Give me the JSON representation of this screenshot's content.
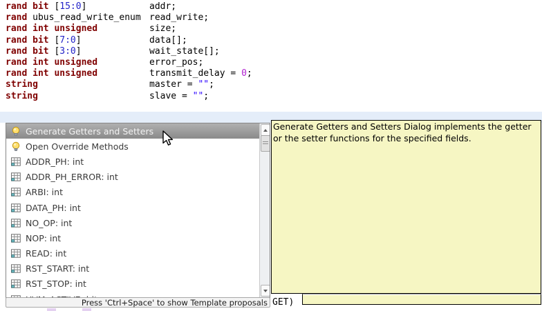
{
  "colors": {
    "keyword": "#7f0000",
    "range_number": "#2222c8",
    "literal_number": "#b020d0",
    "string_literal": "#2a00ff",
    "code_text": "#000000",
    "band": "#e4edf9",
    "selection_top": "#b0b0b0",
    "selection_bottom": "#8a8a8a",
    "selection_text": "#f2f2f2",
    "list_text": "#3a3a3a",
    "tooltip_bg": "#f6f6c3",
    "tooltip_border": "#000000",
    "popup_border": "#868686",
    "status_bg": "#f3f3f3",
    "status_border": "#a8a8a8"
  },
  "editor": {
    "lines": [
      {
        "type_tokens": [
          {
            "text": "rand bit",
            "cls": "kw"
          },
          {
            "text": " [",
            "cls": "pl"
          },
          {
            "text": "15:0",
            "cls": "rng"
          },
          {
            "text": "]",
            "cls": "pl"
          }
        ],
        "name_tokens": [
          {
            "text": "addr;",
            "cls": "pl"
          }
        ]
      },
      {
        "type_tokens": [
          {
            "text": "rand",
            "cls": "kw"
          },
          {
            "text": " ubus_read_write_enum",
            "cls": "pl"
          }
        ],
        "name_tokens": [
          {
            "text": "read_write;",
            "cls": "pl"
          }
        ]
      },
      {
        "type_tokens": [
          {
            "text": "rand int unsigned",
            "cls": "kw"
          }
        ],
        "name_tokens": [
          {
            "text": "size;",
            "cls": "pl"
          }
        ]
      },
      {
        "type_tokens": [
          {
            "text": "rand bit",
            "cls": "kw"
          },
          {
            "text": " [",
            "cls": "pl"
          },
          {
            "text": "7:0",
            "cls": "rng"
          },
          {
            "text": "]",
            "cls": "pl"
          }
        ],
        "name_tokens": [
          {
            "text": "data[];",
            "cls": "pl"
          }
        ]
      },
      {
        "type_tokens": [
          {
            "text": "rand bit",
            "cls": "kw"
          },
          {
            "text": " [",
            "cls": "pl"
          },
          {
            "text": "3:0",
            "cls": "rng"
          },
          {
            "text": "]",
            "cls": "pl"
          }
        ],
        "name_tokens": [
          {
            "text": "wait_state[];",
            "cls": "pl"
          }
        ]
      },
      {
        "type_tokens": [
          {
            "text": "rand int unsigned",
            "cls": "kw"
          }
        ],
        "name_tokens": [
          {
            "text": "error_pos;",
            "cls": "pl"
          }
        ]
      },
      {
        "type_tokens": [
          {
            "text": "rand int unsigned",
            "cls": "kw"
          }
        ],
        "name_tokens": [
          {
            "text": "transmit_delay = ",
            "cls": "pl"
          },
          {
            "text": "0",
            "cls": "lit"
          },
          {
            "text": ";",
            "cls": "pl"
          }
        ]
      },
      {
        "type_tokens": [
          {
            "text": "string",
            "cls": "kw"
          }
        ],
        "name_tokens": [
          {
            "text": "master = ",
            "cls": "pl"
          },
          {
            "text": "\"\"",
            "cls": "str"
          },
          {
            "text": ";",
            "cls": "pl"
          }
        ]
      },
      {
        "type_tokens": [
          {
            "text": "string",
            "cls": "kw"
          }
        ],
        "name_tokens": [
          {
            "text": "slave = ",
            "cls": "pl"
          },
          {
            "text": "\"\"",
            "cls": "str"
          },
          {
            "text": ";",
            "cls": "pl"
          }
        ]
      }
    ]
  },
  "popup": {
    "items": [
      {
        "icon": "bulb",
        "label": "Generate Getters and Setters",
        "selected": true
      },
      {
        "icon": "bulb",
        "label": "Open Override Methods",
        "selected": false
      },
      {
        "icon": "table",
        "label": "ADDR_PH: int",
        "selected": false
      },
      {
        "icon": "table",
        "label": "ADDR_PH_ERROR: int",
        "selected": false
      },
      {
        "icon": "table",
        "label": "ARBI: int",
        "selected": false
      },
      {
        "icon": "table",
        "label": "DATA_PH: int",
        "selected": false
      },
      {
        "icon": "table",
        "label": "NO_OP: int",
        "selected": false
      },
      {
        "icon": "table",
        "label": "NOP: int",
        "selected": false
      },
      {
        "icon": "table",
        "label": "READ: int",
        "selected": false
      },
      {
        "icon": "table",
        "label": "RST_START: int",
        "selected": false
      },
      {
        "icon": "table",
        "label": "RST_STOP: int",
        "selected": false
      },
      {
        "icon": "table",
        "label": "UVM_ACTIVE: bit",
        "selected": false
      }
    ]
  },
  "status_bar": {
    "text": "Press 'Ctrl+Space' to show Template proposals"
  },
  "tooltip": {
    "text": "Generate Getters and Setters Dialog implements the getter or the setter functions for the specified fields."
  },
  "fragments": {
    "occluded_text": "GET)"
  }
}
